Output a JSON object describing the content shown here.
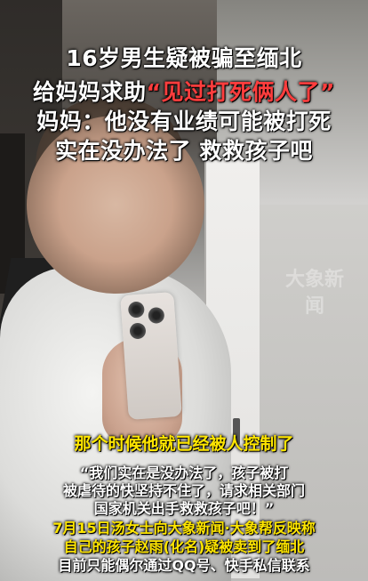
{
  "headline": {
    "line1": "16岁男生疑被骗至缅北",
    "line2_prefix": "给妈妈求助",
    "line2_quote": "“见过打死俩人了”",
    "line3": "妈妈：他没有业绩可能被打死",
    "line4": "实在没办法了 救救孩子吧"
  },
  "watermark": "大象新闻",
  "caption": "那个时候他就已经被人控制了",
  "quote_lines": [
    "“我们实在是没办法了，孩子被打",
    "被虐待的快坚持不住了，请求相关部门",
    "国家机关出手救救孩子吧！”"
  ],
  "news_lines": [
    "7月15日汤女士向大象新闻·大象帮反映称",
    "自己的孩子赵雨(化名)疑被卖到了缅北",
    "目前只能偶尔通过QQ号、快手私信联系"
  ],
  "colors": {
    "headline": "#ffffff",
    "quote_red": "#ff3d3d",
    "caption_yellow": "#ffe600"
  }
}
